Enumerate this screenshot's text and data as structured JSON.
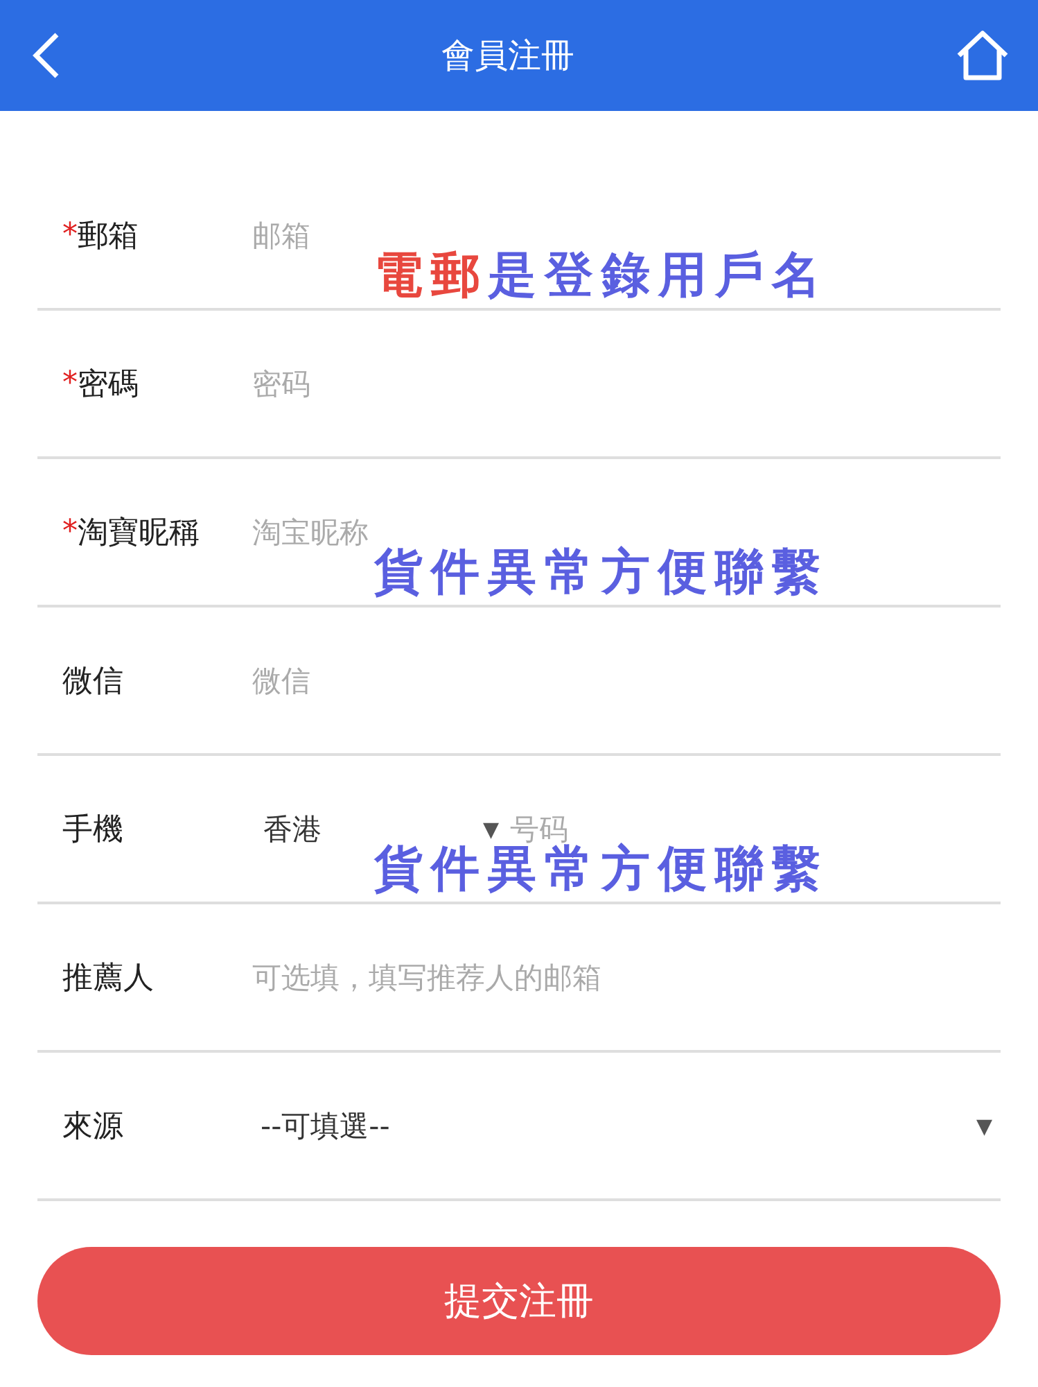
{
  "header": {
    "title": "會員注冊"
  },
  "fields": [
    {
      "kind": "text",
      "mark": "*",
      "label": "郵箱",
      "placeholder": "邮箱",
      "note": [
        {
          "text": "電郵",
          "color": "#e8473e"
        },
        {
          "text": "是登錄用戶名",
          "color": "#5a5fe0"
        }
      ]
    },
    {
      "kind": "text",
      "mark": "*",
      "label": "密碼",
      "placeholder": "密码"
    },
    {
      "kind": "text",
      "mark": "*",
      "label": "淘寶昵稱",
      "placeholder": "淘宝昵称",
      "note": [
        {
          "text": "貨件異常方便聯繫",
          "color": "#5a5fe0"
        }
      ]
    },
    {
      "kind": "text",
      "label": "微信",
      "placeholder": "微信"
    },
    {
      "kind": "phone",
      "label": "手機",
      "region": "香港",
      "caret": "▼",
      "placeholder": "号码",
      "note": [
        {
          "text": "貨件異常方便聯繫",
          "color": "#5a5fe0"
        }
      ]
    },
    {
      "kind": "text",
      "label": "推薦人",
      "placeholder": "可选填，填写推荐人的邮箱"
    },
    {
      "kind": "select",
      "label": "來源",
      "value": "--可填選--",
      "caret": "▼"
    }
  ],
  "submit": "提交注冊"
}
